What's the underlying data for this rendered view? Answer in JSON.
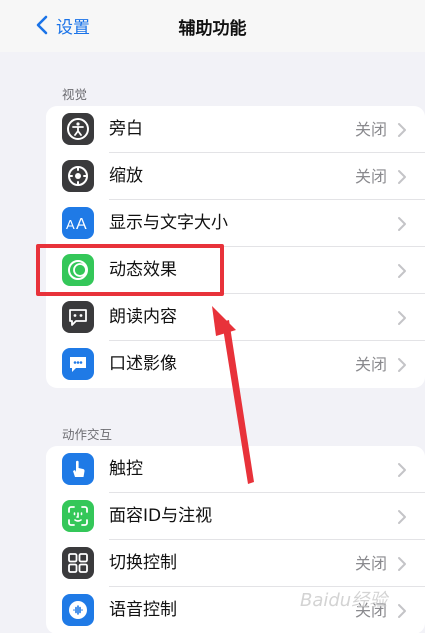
{
  "nav": {
    "back_label": "设置",
    "title": "辅助功能"
  },
  "sections": [
    {
      "header": "视觉",
      "items": [
        {
          "label": "旁白",
          "value": "关闭",
          "icon": "voiceover-icon",
          "icon_bg": "#3a3a3c"
        },
        {
          "label": "缩放",
          "value": "关闭",
          "icon": "zoom-icon",
          "icon_bg": "#3a3a3c"
        },
        {
          "label": "显示与文字大小",
          "value": "",
          "icon": "text-size-icon",
          "icon_bg": "#1f7ae6"
        },
        {
          "label": "动态效果",
          "value": "",
          "icon": "motion-icon",
          "icon_bg": "#34c759"
        },
        {
          "label": "朗读内容",
          "value": "",
          "icon": "spoken-content-icon",
          "icon_bg": "#3a3a3c"
        },
        {
          "label": "口述影像",
          "value": "关闭",
          "icon": "audio-description-icon",
          "icon_bg": "#1f7ae6"
        }
      ]
    },
    {
      "header": "动作交互",
      "items": [
        {
          "label": "触控",
          "value": "",
          "icon": "touch-icon",
          "icon_bg": "#1f7ae6"
        },
        {
          "label": "面容ID与注视",
          "value": "",
          "icon": "face-id-icon",
          "icon_bg": "#34c759"
        },
        {
          "label": "切换控制",
          "value": "关闭",
          "icon": "switch-control-icon",
          "icon_bg": "#3a3a3c"
        },
        {
          "label": "语音控制",
          "value": "关闭",
          "icon": "voice-control-icon",
          "icon_bg": "#1f7ae6"
        }
      ]
    }
  ],
  "annotation": {
    "highlight_color": "#e8323a"
  },
  "watermark": "Baidu经验"
}
